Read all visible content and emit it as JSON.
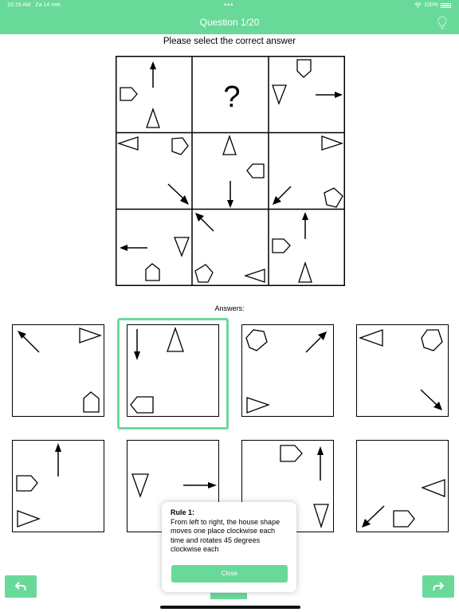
{
  "status_bar": {
    "time": "10:19 AM",
    "date": "Za 14 mei",
    "battery": "100%",
    "menu_dots": "•••"
  },
  "header": {
    "title": "Question 1/20",
    "hint_icon": "lightbulb-icon"
  },
  "prompt": "Please select the correct answer",
  "puzzle": {
    "missing_cell_symbol": "?"
  },
  "answers_label": "Answers:",
  "answers": {
    "count": 8,
    "selected_index": 1
  },
  "tooltip": {
    "title": "Rule 1:",
    "body": "From left to right, the house shape moves one place clockwise each time and rotates 45 degrees clockwise each",
    "close_label": "Close"
  },
  "nav": {
    "back_icon": "undo-arrow-icon",
    "next_icon": "redo-arrow-icon"
  },
  "colors": {
    "accent": "#69d99a"
  }
}
